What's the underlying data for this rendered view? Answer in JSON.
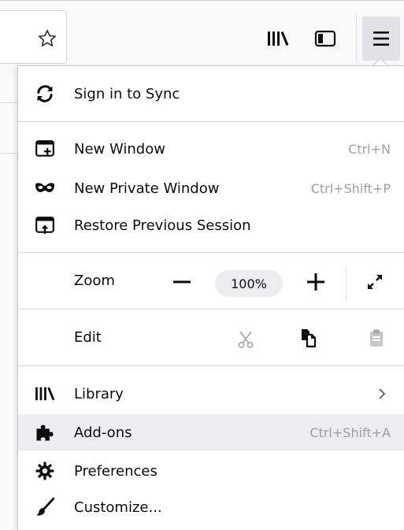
{
  "toolbar": {
    "icons": [
      "star-icon",
      "library-icon",
      "sidebar-icon",
      "hamburger-menu-icon"
    ]
  },
  "menu": {
    "sync": {
      "label": "Sign in to Sync",
      "icon": "sync-icon"
    },
    "new_window": {
      "label": "New Window",
      "shortcut": "Ctrl+N",
      "icon": "new-window-icon"
    },
    "private_window": {
      "label": "New Private Window",
      "shortcut": "Ctrl+Shift+P",
      "icon": "private-mask-icon"
    },
    "restore_session": {
      "label": "Restore Previous Session",
      "icon": "restore-session-icon"
    },
    "zoom": {
      "label": "Zoom",
      "value": "100%"
    },
    "edit": {
      "label": "Edit",
      "icons": [
        "scissors-icon",
        "copy-icon",
        "paste-icon"
      ]
    },
    "library": {
      "label": "Library",
      "icon": "library-icon"
    },
    "addons": {
      "label": "Add-ons",
      "shortcut": "Ctrl+Shift+A",
      "icon": "puzzle-icon"
    },
    "preferences": {
      "label": "Preferences",
      "icon": "gear-icon"
    },
    "customize": {
      "label": "Customize...",
      "icon": "paintbrush-icon"
    }
  },
  "colors": {
    "toolbar_bg": "#f9f9fa",
    "active_button_bg": "#e2e2e6",
    "hover_row_bg": "#ededf0",
    "shortcut_text": "#9e9ea6",
    "separator": "#d7d7db"
  }
}
